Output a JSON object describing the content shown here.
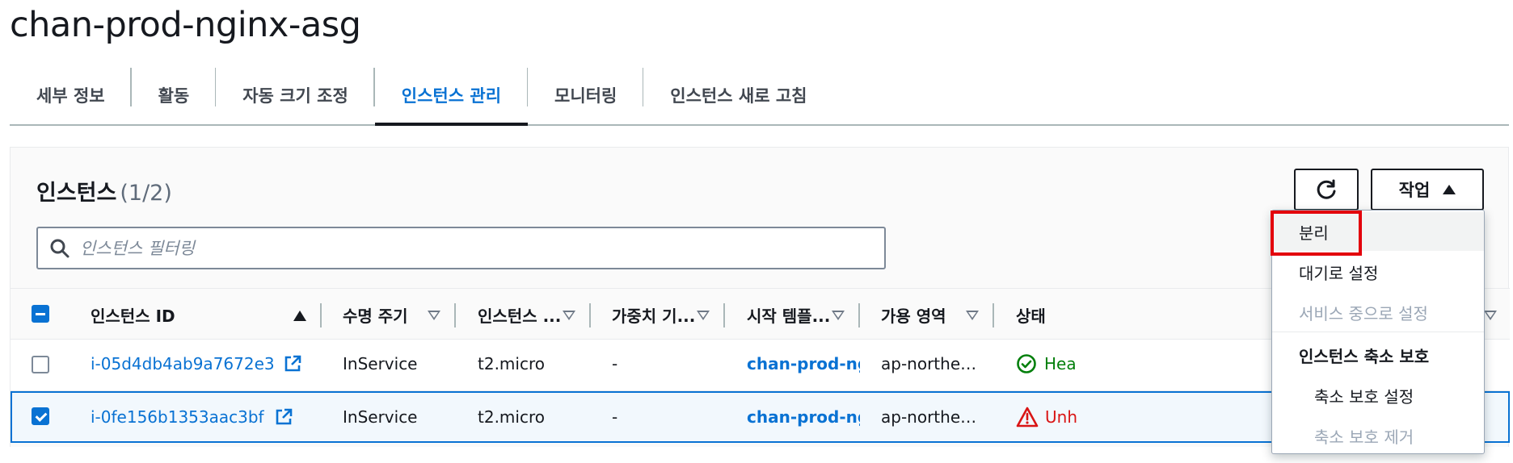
{
  "page": {
    "title": "chan-prod-nginx-asg"
  },
  "tabs": [
    {
      "label": "세부 정보",
      "active": false
    },
    {
      "label": "활동",
      "active": false
    },
    {
      "label": "자동 크기 조정",
      "active": false
    },
    {
      "label": "인스턴스 관리",
      "active": true
    },
    {
      "label": "모니터링",
      "active": false
    },
    {
      "label": "인스턴스 새로 고침",
      "active": false
    }
  ],
  "instances": {
    "heading": "인스턴스",
    "count": "(1/2)",
    "actions_label": "작업",
    "search_placeholder": "인스턴스 필터링"
  },
  "table": {
    "columns": [
      {
        "label": "인스턴스 ID"
      },
      {
        "label": "수명 주기"
      },
      {
        "label": "인스턴스 ..."
      },
      {
        "label": "가중치 기..."
      },
      {
        "label": "시작 템플..."
      },
      {
        "label": "가용 영역"
      },
      {
        "label": "상태"
      }
    ],
    "rows": [
      {
        "selected": false,
        "id": "i-05d4db4ab9a7672e3",
        "lifecycle": "InService",
        "type": "t2.micro",
        "weight": "-",
        "template": "chan-prod-ngin",
        "az": "ap-northe…",
        "health": "Hea",
        "health_icon": "check-circle-icon"
      },
      {
        "selected": true,
        "id": "i-0fe156b1353aac3bf",
        "lifecycle": "InService",
        "type": "t2.micro",
        "weight": "-",
        "template": "chan-prod-ngin",
        "az": "ap-northe…",
        "health": "Unh",
        "health_icon": "warning-triangle-icon"
      }
    ]
  },
  "dropdown": {
    "items": [
      {
        "label": "분리",
        "disabled": false
      },
      {
        "label": "대기로 설정",
        "disabled": false
      },
      {
        "label": "서비스 중으로 설정",
        "disabled": true
      }
    ],
    "group": {
      "label": "인스턴스 축소 보호",
      "items": [
        {
          "label": "축소 보호 설정",
          "disabled": false
        },
        {
          "label": "축소 보호 제거",
          "disabled": true
        }
      ]
    }
  },
  "colors": {
    "link": "#0972d3",
    "success": "#037f0c",
    "error": "#d91515",
    "highlight": "#e3000b"
  }
}
